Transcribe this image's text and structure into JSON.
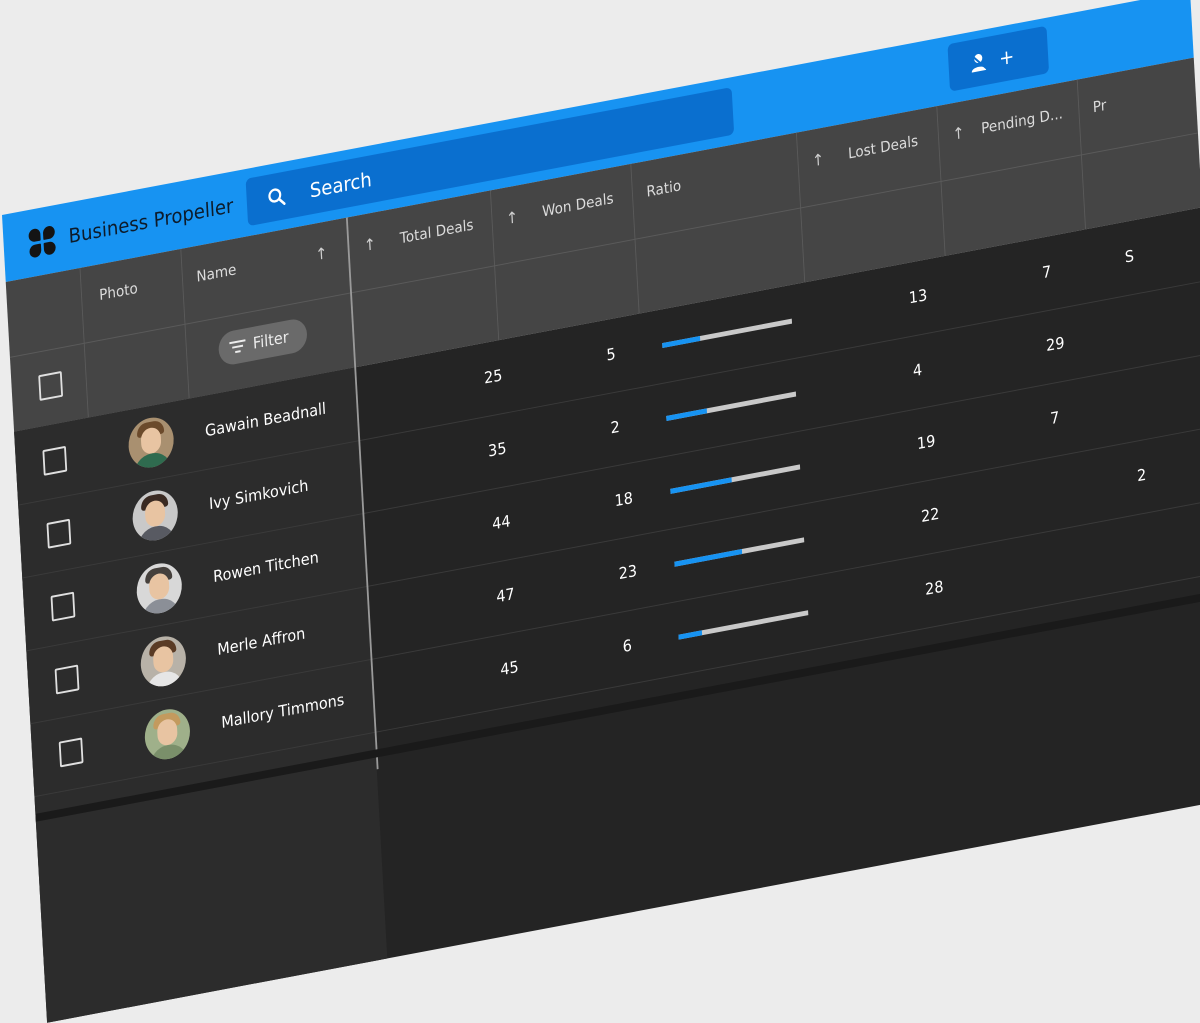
{
  "app": {
    "brand": "Business Propeller",
    "brand_icon": "clover-logo-icon"
  },
  "search": {
    "placeholder": "Search",
    "icon": "search-icon"
  },
  "toolbar": {
    "action_label": "+",
    "action_icon": "add-user-icon"
  },
  "columns": {
    "photo": "Photo",
    "name": "Name",
    "total_deals": "Total Deals",
    "won_deals": "Won Deals",
    "ratio": "Ratio",
    "lost_deals": "Lost Deals",
    "pending_deals": "Pending D...",
    "partial": "Pr"
  },
  "filter": {
    "label": "Filter",
    "icon": "filter-icon"
  },
  "colors": {
    "accent": "#1793f2",
    "appbar": "#1793f2",
    "search_bg": "#0a6fcf",
    "grid_bg": "#242424",
    "header_bg": "#454545"
  },
  "rows": [
    {
      "name": "Gawain Beadnall",
      "total": "25",
      "won": "5",
      "ratio": 0.29,
      "lost": "13",
      "pending": "7",
      "partial": "S"
    },
    {
      "name": "Ivy Simkovich",
      "total": "35",
      "won": "2",
      "ratio": 0.31,
      "lost": "4",
      "pending": "29",
      "partial": ""
    },
    {
      "name": "Rowen Titchen",
      "total": "44",
      "won": "18",
      "ratio": 0.47,
      "lost": "19",
      "pending": "7",
      "partial": ""
    },
    {
      "name": "Merle Affron",
      "total": "47",
      "won": "23",
      "ratio": 0.52,
      "lost": "22",
      "pending": "",
      "partial": "2"
    },
    {
      "name": "Mallory Timmons",
      "total": "45",
      "won": "6",
      "ratio": 0.18,
      "lost": "28",
      "pending": "",
      "partial": ""
    }
  ]
}
